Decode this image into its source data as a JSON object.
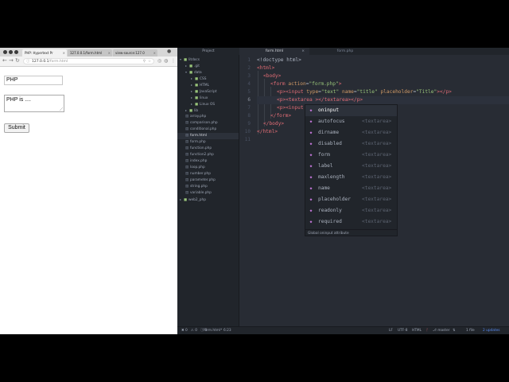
{
  "browser": {
    "tabs": [
      {
        "title": "PHP: Hypertext Pr"
      },
      {
        "title": "127.0.0.1/form.html"
      },
      {
        "title": "view-source:127.0"
      }
    ],
    "tab_close": "×",
    "nav": {
      "back": "←",
      "forward": "→",
      "reload": "↻"
    },
    "url_host": "127.0.0.1",
    "url_path": "/form.html",
    "page": {
      "input_value": "PHP",
      "textarea_value": "PHP is ....",
      "submit_label": "Submit"
    }
  },
  "editor": {
    "project_title": "Project",
    "tabs": [
      {
        "title": "form.html"
      },
      {
        "title": "form.php"
      }
    ],
    "tree": [
      {
        "label": "litdocs",
        "type": "dir",
        "depth": 0,
        "open": true
      },
      {
        "label": ".git",
        "type": "dir",
        "depth": 1,
        "open": false
      },
      {
        "label": "data",
        "type": "dir",
        "depth": 1,
        "open": true
      },
      {
        "label": "CSS",
        "type": "dir",
        "depth": 2
      },
      {
        "label": "HTML",
        "type": "dir",
        "depth": 2
      },
      {
        "label": "JavaScript",
        "type": "dir",
        "depth": 2
      },
      {
        "label": "linux",
        "type": "dir",
        "depth": 2
      },
      {
        "label": "Linux OS",
        "type": "dir",
        "depth": 2
      },
      {
        "label": "lib",
        "type": "dir",
        "depth": 1,
        "open": false
      },
      {
        "label": "array.php",
        "type": "file",
        "depth": 1
      },
      {
        "label": "comparison.php",
        "type": "file",
        "depth": 1
      },
      {
        "label": "conditional.php",
        "type": "file",
        "depth": 1
      },
      {
        "label": "form.html",
        "type": "file",
        "depth": 1,
        "selected": true
      },
      {
        "label": "form.php",
        "type": "file",
        "depth": 1
      },
      {
        "label": "function.php",
        "type": "file",
        "depth": 1
      },
      {
        "label": "function2.php",
        "type": "file",
        "depth": 1
      },
      {
        "label": "index.php",
        "type": "file",
        "depth": 1
      },
      {
        "label": "loop.php",
        "type": "file",
        "depth": 1
      },
      {
        "label": "number.php",
        "type": "file",
        "depth": 1
      },
      {
        "label": "parameter.php",
        "type": "file",
        "depth": 1
      },
      {
        "label": "string.php",
        "type": "file",
        "depth": 1
      },
      {
        "label": "variable.php",
        "type": "file",
        "depth": 1
      },
      {
        "label": "web2_php",
        "type": "dir",
        "depth": 0,
        "open": false
      }
    ],
    "line_numbers": [
      "1",
      "2",
      "3",
      "4",
      "5",
      "6",
      "7",
      "8",
      "9",
      "10",
      "11"
    ],
    "code": {
      "l1": "<!doctype html>",
      "l2_tag": "<html>",
      "l3_tag": "<body>",
      "l4_open": "<form ",
      "l4_attr": "action",
      "l4_eq": "=",
      "l4_val": "\"form.php\"",
      "l4_close": ">",
      "l5_p": "<p>",
      "l5_input": "<input ",
      "l5_a1": "type",
      "l5_v1": "\"text\"",
      "l5_a2": "name",
      "l5_v2": "\"title\"",
      "l5_a3": "placeholder",
      "l5_v3": "\"Title\"",
      "l5_end": "></p>",
      "l6_p": "<p>",
      "l6_ta": "<textarea ",
      "l6_mid": "></textarea>",
      "l6_end": "</p>",
      "l7_p": "<p>",
      "l7_input": "<input",
      "l8_tag": "</form>",
      "l9_tag": "</body>",
      "l10_tag": "</html>",
      "eq": "=",
      "sp": " "
    },
    "autocomplete": {
      "items": [
        {
          "name": "oninput",
          "type": ""
        },
        {
          "name": "autofocus",
          "type": "<textarea>"
        },
        {
          "name": "dirname",
          "type": "<textarea>"
        },
        {
          "name": "disabled",
          "type": "<textarea>"
        },
        {
          "name": "form",
          "type": "<textarea>"
        },
        {
          "name": "label",
          "type": "<textarea>"
        },
        {
          "name": "maxlength",
          "type": "<textarea>"
        },
        {
          "name": "name",
          "type": "<textarea>"
        },
        {
          "name": "placeholder",
          "type": "<textarea>"
        },
        {
          "name": "readonly",
          "type": "<textarea>"
        },
        {
          "name": "required",
          "type": "<textarea>"
        }
      ],
      "description": "Global oninput attribute"
    },
    "status": {
      "errors": "0",
      "warnings": "0",
      "infos": "0",
      "file": "form.html*",
      "cursor": "6:23",
      "line_ending": "LF",
      "encoding": "UTF-8",
      "grammar": "HTML",
      "branch": "master",
      "files": "1 file",
      "updates": "2 updates"
    }
  },
  "colors": {
    "editor_bg": "#282c34",
    "tag": "#e06c75",
    "attr": "#d19a66",
    "string": "#98c379",
    "accent": "#568af2"
  }
}
